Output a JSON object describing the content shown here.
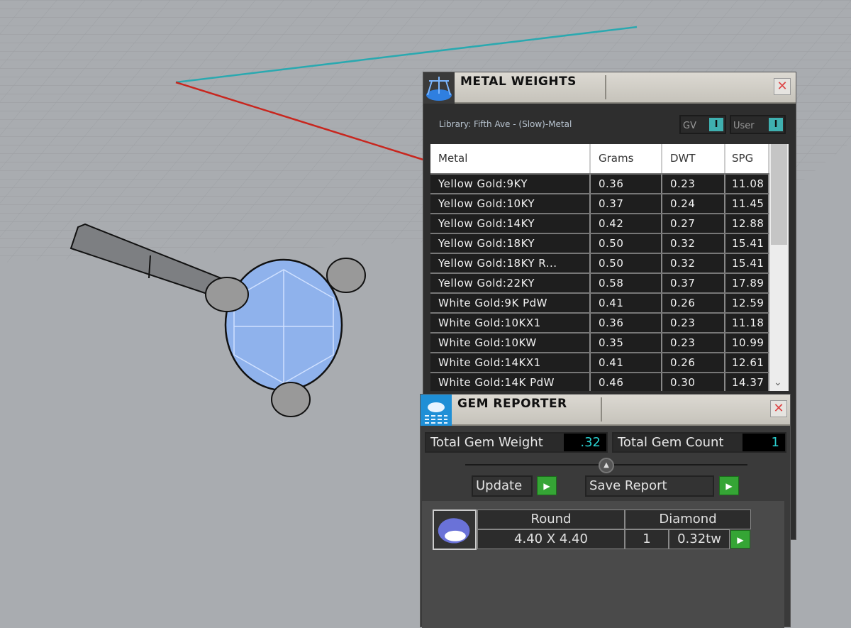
{
  "metal_weights": {
    "title": "METAL WEIGHTS",
    "library": "Library: Fifth Ave - (Slow)-Metal",
    "toggles": [
      {
        "label": "GV",
        "state": "I"
      },
      {
        "label": "User",
        "state": "I"
      }
    ],
    "columns": [
      "Metal",
      "Grams",
      "DWT",
      "SPG"
    ],
    "rows": [
      [
        "Yellow Gold:9KY",
        "0.36",
        "0.23",
        "11.08"
      ],
      [
        "Yellow Gold:10KY",
        "0.37",
        "0.24",
        "11.45"
      ],
      [
        "Yellow Gold:14KY",
        "0.42",
        "0.27",
        "12.88"
      ],
      [
        "Yellow Gold:18KY",
        "0.50",
        "0.32",
        "15.41"
      ],
      [
        "Yellow Gold:18KY R...",
        "0.50",
        "0.32",
        "15.41"
      ],
      [
        "Yellow Gold:22KY",
        "0.58",
        "0.37",
        "17.89"
      ],
      [
        "White Gold:9K PdW",
        "0.41",
        "0.26",
        "12.59"
      ],
      [
        "White Gold:10KX1",
        "0.36",
        "0.23",
        "11.18"
      ],
      [
        "White Gold:10KW",
        "0.35",
        "0.23",
        "10.99"
      ],
      [
        "White Gold:14KX1",
        "0.41",
        "0.26",
        "12.61"
      ],
      [
        "White Gold:14K PdW",
        "0.46",
        "0.30",
        "14.37"
      ]
    ],
    "close": "✕"
  },
  "gem_reporter": {
    "title": "GEM REPORTER",
    "total_weight_label": "Total Gem Weight",
    "total_weight": ".32",
    "total_count_label": "Total Gem Count",
    "total_count": "1",
    "update": "Update",
    "save_report": "Save Report",
    "gems": [
      {
        "shape": "Round",
        "material": "Diamond",
        "size": "4.40 X 4.40",
        "count": "1",
        "weight": "0.32tw"
      }
    ],
    "close": "✕"
  },
  "colors": {
    "accent": "#3fb0b0",
    "go": "#35a535",
    "value": "#2ad0d0"
  }
}
